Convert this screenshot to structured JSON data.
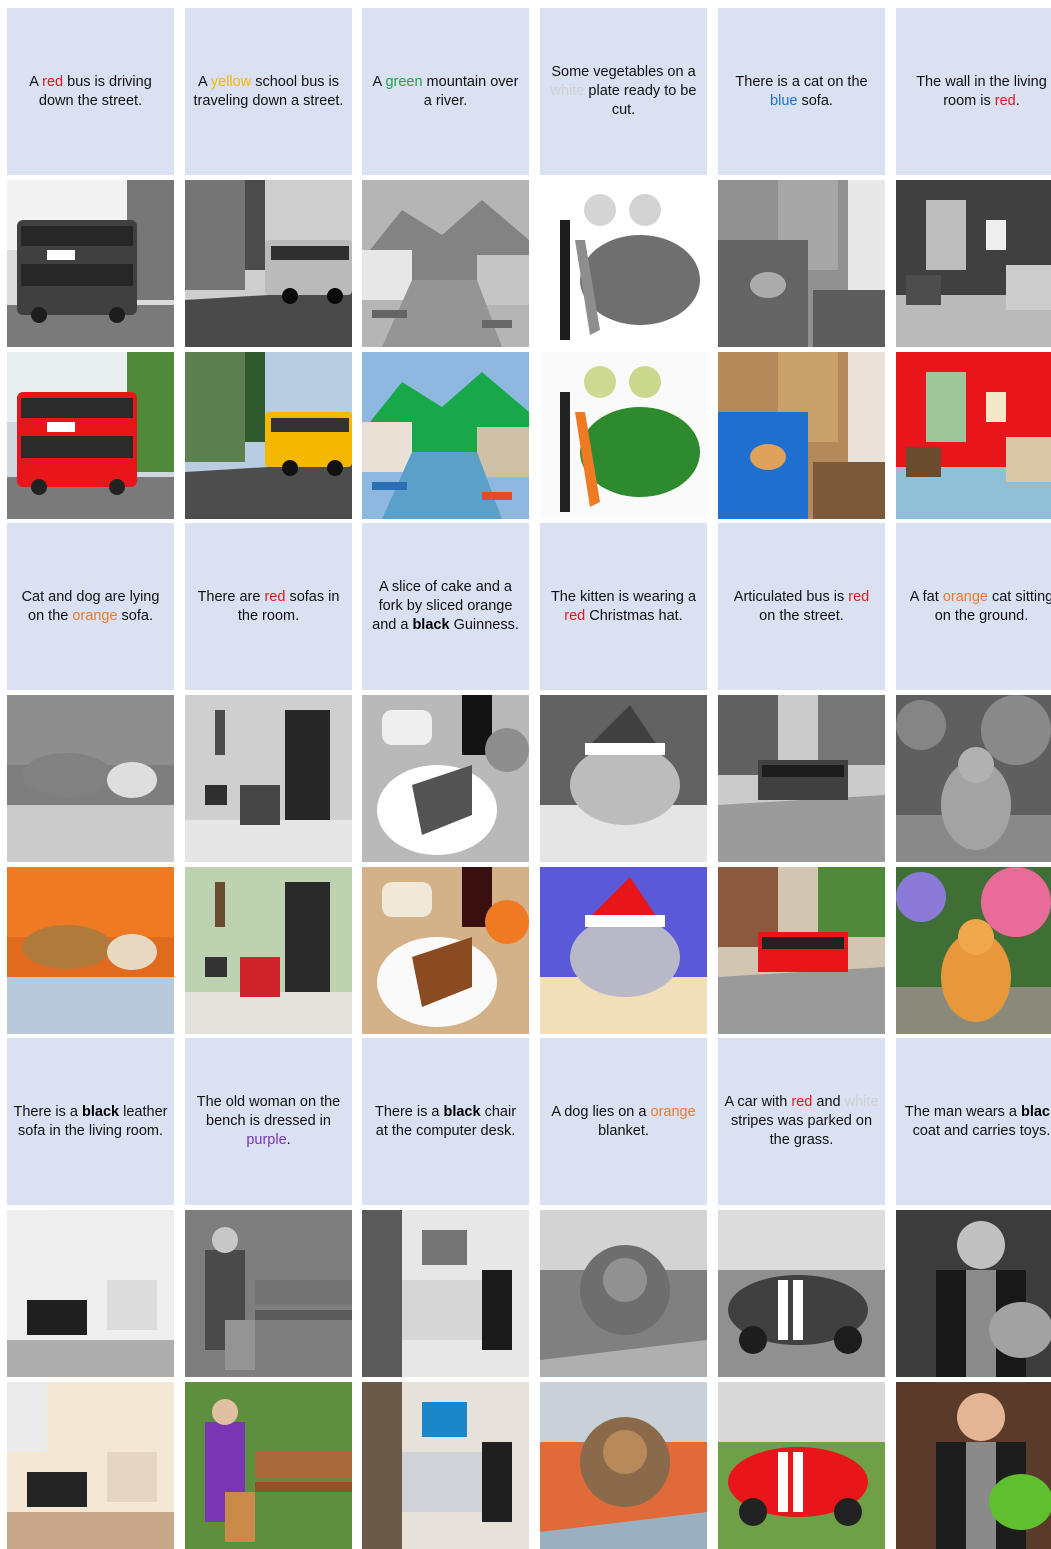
{
  "colors": {
    "red": "#e8161b",
    "yellow": "#f5b800",
    "green": "#18a84a",
    "white": "#d0d0d0",
    "blue": "#1f6fd1",
    "orange": "#f07a24",
    "purple": "#7a35b5",
    "black": "#000000",
    "caption_bg": "#d9e1f2"
  },
  "blocks": [
    {
      "captions": [
        [
          {
            "t": "A "
          },
          {
            "t": "red",
            "c": "red"
          },
          {
            "t": " bus is driving down the street."
          }
        ],
        [
          {
            "t": "A "
          },
          {
            "t": "yellow",
            "c": "yellow"
          },
          {
            "t": " school bus is traveling down a street."
          }
        ],
        [
          {
            "t": "A "
          },
          {
            "t": "green",
            "c": "green"
          },
          {
            "t": " mountain over a river."
          }
        ],
        [
          {
            "t": "Some vegetables on a "
          },
          {
            "t": "white",
            "c": "white"
          },
          {
            "t": " plate ready to be cut."
          }
        ],
        [
          {
            "t": "There is a cat on the "
          },
          {
            "t": "blue",
            "c": "blue"
          },
          {
            "t": " sofa."
          }
        ],
        [
          {
            "t": "The wall in the living room is "
          },
          {
            "t": "red",
            "c": "red"
          },
          {
            "t": "."
          }
        ]
      ],
      "scenes": [
        "bus-double-decker",
        "school-bus",
        "river-mountain",
        "vegetables",
        "cat-blue-sofa",
        "red-living-room"
      ]
    },
    {
      "captions": [
        [
          {
            "t": "Cat and dog are lying on the "
          },
          {
            "t": "orange",
            "c": "orange"
          },
          {
            "t": " sofa."
          }
        ],
        [
          {
            "t": "There are "
          },
          {
            "t": "red",
            "c": "red"
          },
          {
            "t": " sofas in the room."
          }
        ],
        [
          {
            "t": "A slice of cake and a fork by sliced orange and a "
          },
          {
            "t": "black",
            "c": "black",
            "b": true
          },
          {
            "t": " Guinness."
          }
        ],
        [
          {
            "t": "The kitten is wearing a "
          },
          {
            "t": "red",
            "c": "red"
          },
          {
            "t": " Christmas hat."
          }
        ],
        [
          {
            "t": "Articulated bus is "
          },
          {
            "t": "red",
            "c": "red"
          },
          {
            "t": " on the street."
          }
        ],
        [
          {
            "t": "A fat "
          },
          {
            "t": "orange",
            "c": "orange"
          },
          {
            "t": " cat sitting on the ground."
          }
        ]
      ],
      "scenes": [
        "cat-dog-sofa",
        "room-red-armchair",
        "cake-orange",
        "kitten-hat",
        "articulated-bus",
        "orange-cat-flowers"
      ]
    },
    {
      "captions": [
        [
          {
            "t": "There is a "
          },
          {
            "t": "black",
            "c": "black",
            "b": true
          },
          {
            "t": " leather sofa in the living room."
          }
        ],
        [
          {
            "t": "The old woman on the bench is dressed in "
          },
          {
            "t": "purple",
            "c": "purple"
          },
          {
            "t": "."
          }
        ],
        [
          {
            "t": "There is a "
          },
          {
            "t": "black",
            "c": "black",
            "b": true
          },
          {
            "t": " chair at the computer desk."
          }
        ],
        [
          {
            "t": "A dog lies on a "
          },
          {
            "t": "orange",
            "c": "orange"
          },
          {
            "t": " blanket."
          }
        ],
        [
          {
            "t": "A car with "
          },
          {
            "t": "red",
            "c": "red"
          },
          {
            "t": " and "
          },
          {
            "t": "white",
            "c": "white"
          },
          {
            "t": " stripes was parked on the grass."
          }
        ],
        [
          {
            "t": "The man wears a "
          },
          {
            "t": "black",
            "c": "black",
            "b": true
          },
          {
            "t": " coat and carries toys."
          }
        ]
      ],
      "scenes": [
        "black-sofa-room",
        "old-woman-bench",
        "computer-desk",
        "dog-blanket",
        "red-sports-car",
        "man-toys"
      ]
    }
  ]
}
